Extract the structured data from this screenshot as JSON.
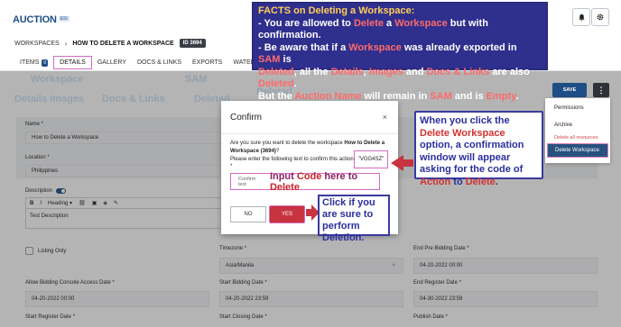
{
  "header": {
    "logo_text": "AUCTION",
    "logo_badge": "ESI",
    "notifications_icon": "bell-icon",
    "settings_icon": "gear-icon"
  },
  "breadcrumb": {
    "root": "WORKSPACES",
    "current": "HOW TO DELETE A WORKSPACE",
    "id_badge": "ID 3694"
  },
  "tabs": [
    {
      "label": "ITEMS",
      "count": "0"
    },
    {
      "label": "DETAILS"
    },
    {
      "label": "GALLERY"
    },
    {
      "label": "DOCS & LINKS"
    },
    {
      "label": "EXPORTS"
    },
    {
      "label": "WATERMARK"
    }
  ],
  "ghost_text": {
    "g1": "Workspace",
    "g2": "SAM",
    "g3": "Deleted",
    "g4": "Details  Images",
    "g5": "Docs & Links",
    "g6": "Deleted"
  },
  "actions": {
    "save_label": "SAVE",
    "more_label": "⋮"
  },
  "menu": {
    "items": [
      "Permissions",
      "Archive",
      "Delete all resources",
      "Delete Workspace"
    ]
  },
  "form": {
    "name_label": "Name *",
    "name_value": "How to Delete a Workspace",
    "location_label": "Location *",
    "location_value": "Philippines",
    "description_label": "Description",
    "editor_heading": "Heading",
    "editor_text": "Test Description",
    "listing_only_label": "Listing Only",
    "timezone_label": "Timezone *",
    "timezone_value": "Asia/Manila",
    "end_pre_bidding_label": "End Pre Bidding Date *",
    "end_pre_bidding_value": "04-20-2022 00:00",
    "allow_console_label": "Allow Bidding Console Access Date *",
    "allow_console_value": "04-20-2022 00:00",
    "start_bidding_label": "Start Bidding Date *",
    "start_bidding_value": "04-20-2022 23:59",
    "end_register_label": "End Register Date *",
    "end_register_value": "04-30-2022 23:59",
    "start_register_label": "Start Register Date *",
    "start_closing_label": "Start Closing Date *",
    "publish_label": "Publish Date *"
  },
  "modal": {
    "title": "Confirm",
    "close": "×",
    "question_pre": "Are you sure you want to delete the workspace ",
    "question_bold": "How to Delete a Workspace (3694)",
    "question_post": "?",
    "enter_text": "Please enter the following text to confirm this action:",
    "code": "\"VGG4SZ\"",
    "required_star": "*",
    "input_placeholder": "Confirm text",
    "input_hint_pre": "Input ",
    "input_hint_red": "Code",
    "input_hint_post": " here to ",
    "input_hint_red2": "Delete",
    "no_label": "NO",
    "yes_label": "YES"
  },
  "callouts": {
    "facts_line1": "FACTS on Deleting a Workspace:",
    "facts_line2_a": "- You are allowed to ",
    "facts_line2_b": "Delete",
    "facts_line2_c": " a ",
    "facts_line2_d": "Workspace",
    "facts_line2_e": " but with confirmation.",
    "facts_line3_a": "- Be aware that if a ",
    "facts_line3_b": "Workspace",
    "facts_line3_c": " was already exported in ",
    "facts_line3_d": "SAM",
    "facts_line3_e": " is",
    "facts_line4_a": "Deleted",
    "facts_line4_b": ", all the ",
    "facts_line4_c": "Details",
    "facts_line4_d": ", ",
    "facts_line4_e": "Images",
    "facts_line4_f": " and ",
    "facts_line4_g": "Docs & Links",
    "facts_line4_h": " are also ",
    "facts_line4_i": "Deleted",
    "facts_line4_j": ".",
    "facts_line5_a": "But the ",
    "facts_line5_b": "Auction Name",
    "facts_line5_c": " will remain in ",
    "facts_line5_d": "SAM",
    "facts_line5_e": " and is ",
    "facts_line5_f": "Empty",
    "facts_line5_g": ".",
    "when_a": "When you click the ",
    "when_b": "Delete Workspace",
    "when_c": " option, a confirmation window will appear asking for the code of ",
    "when_d": "Action",
    "when_e": " to ",
    "when_f": "Delete",
    "when_g": ".",
    "click_text": "Click if you are sure to perform Deletion."
  }
}
